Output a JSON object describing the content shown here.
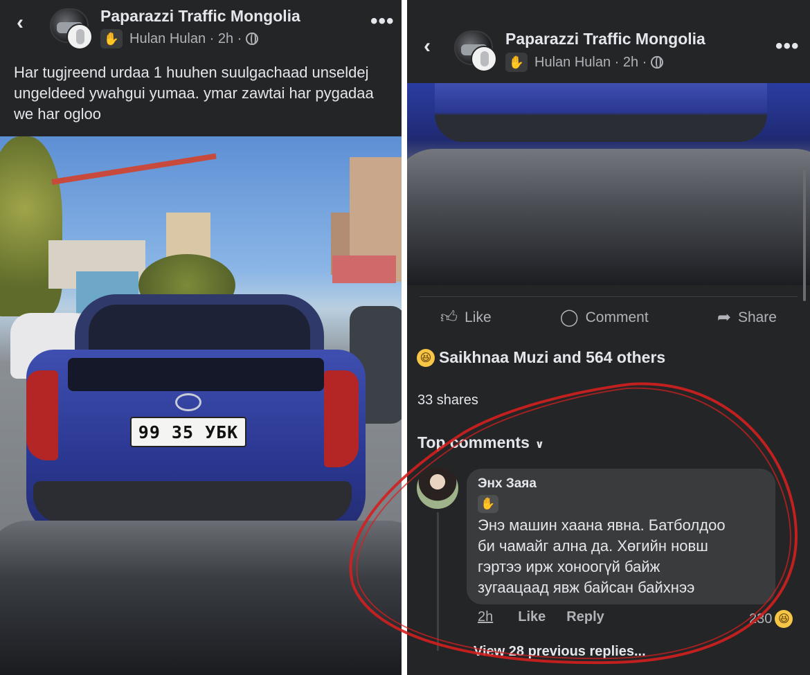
{
  "left": {
    "page_name": "Paparazzi Traffic Mongolia",
    "author": "Hulan Hulan",
    "time": "2h",
    "post_text": "Har tugjreend urdaa 1 huuhen suulgachaad unseldej ungeldeed ywahgui yumaa. ymar zawtai har pygadaa we har ogloo",
    "plate": "99 35 УБК"
  },
  "right": {
    "page_name": "Paparazzi Traffic Mongolia",
    "author": "Hulan Hulan",
    "time": "2h",
    "actions": {
      "like": "Like",
      "comment": "Comment",
      "share": "Share"
    },
    "reactions_text": "Saikhnaa Muzi and 564 others",
    "shares_text": "33 shares",
    "top_comments_label": "Top comments",
    "comment": {
      "author": "Энх Заяа",
      "lines": [
        "Энэ машин хаана явна. Батболдоо",
        "би чамайг ална да. Хөгийн новш",
        "гэртээ ирж хоноогүй байж",
        "зугаацаад явж байсан байхнээ"
      ],
      "time": "2h",
      "like": "Like",
      "reply": "Reply",
      "reaction_count": "230"
    },
    "view_previous": "View 28 previous replies..."
  },
  "colors": {
    "panel_bg": "#242526",
    "bubble_bg": "#3a3b3c",
    "text_primary": "#e4e6eb",
    "text_secondary": "#b0b3b8",
    "annotation": "#d41f1f"
  },
  "icons": {
    "back": "chevron-left-icon",
    "more": "more-horizontal-icon",
    "like": "thumbs-up-icon",
    "comment": "speech-bubble-icon",
    "share": "share-arrow-icon",
    "privacy": "globe-icon",
    "badge": "waving-hand-icon",
    "reaction": "laughing-emoji-icon"
  }
}
